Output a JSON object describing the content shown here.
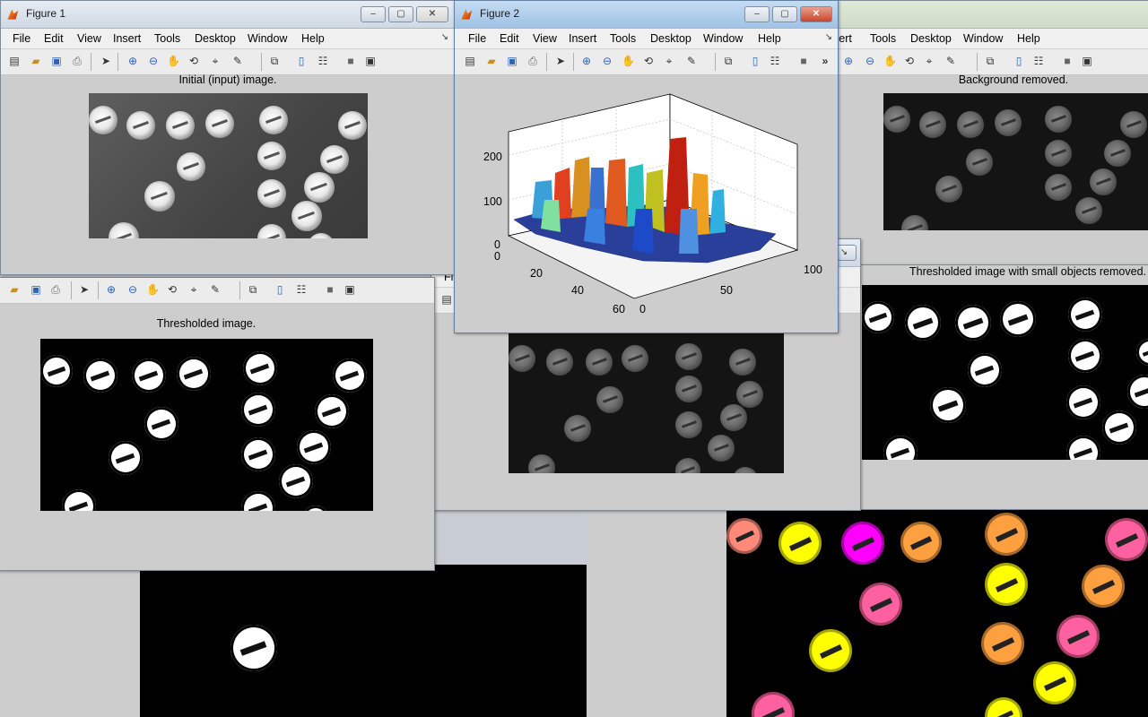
{
  "menu": [
    "File",
    "Edit",
    "View",
    "Insert",
    "Tools",
    "Desktop",
    "Window",
    "Help"
  ],
  "menu_partial_insert": "sert",
  "menu_partial_file": "Fi",
  "figure1": {
    "title": "Figure 1",
    "caption": "Initial (input) image."
  },
  "figure2": {
    "title": "Figure 2",
    "toolbar_more": "»"
  },
  "right_window": {
    "caption": "Background removed."
  },
  "left_window": {
    "caption": "Thresholded image."
  },
  "right_mid_window": {
    "caption": "Thresholded image with small objects removed."
  },
  "window_controls": {
    "minimize": "–",
    "maximize": "▢",
    "close": "✕"
  },
  "icons": {
    "menu_arrow": "↘"
  },
  "chart_data": {
    "type": "surface",
    "x_ticks": [
      "0",
      "20",
      "40",
      "60"
    ],
    "y_ticks": [
      "0",
      "50",
      "100"
    ],
    "z_ticks": [
      "0",
      "100",
      "200"
    ],
    "colormap": "jet",
    "grid": true
  },
  "colors": {
    "coin_colors": [
      "#ff8a7a",
      "#ffff00",
      "#ff00ff",
      "#ffa040",
      "#ff60a0"
    ]
  }
}
